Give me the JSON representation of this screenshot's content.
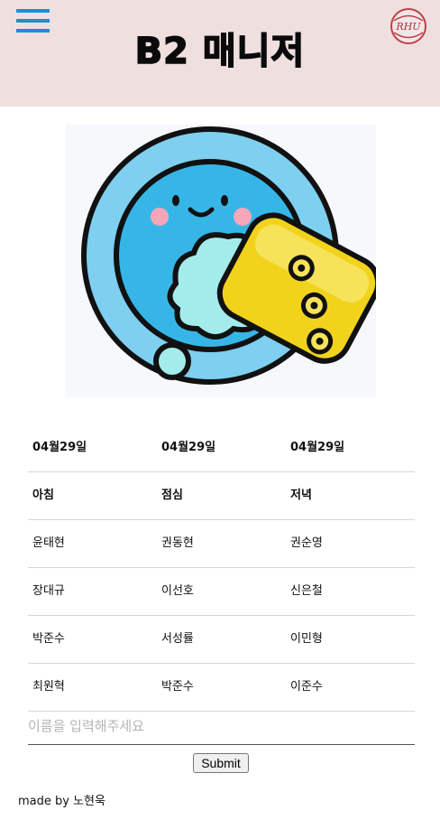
{
  "header": {
    "title": "B2 매니저",
    "logo_text": "RHU"
  },
  "hero": {
    "icon": "dish-washing-sponge-illustration"
  },
  "schedule": {
    "dates": [
      "04월29일",
      "04월29일",
      "04월29일"
    ],
    "meals": [
      "아침",
      "점심",
      "저녁"
    ],
    "rows": [
      [
        "윤태현",
        "권동현",
        "권순영"
      ],
      [
        "장대규",
        "이선호",
        "신은철"
      ],
      [
        "박준수",
        "서성률",
        "이민형"
      ],
      [
        "최원혁",
        "박준수",
        "이준수"
      ]
    ]
  },
  "form": {
    "name_placeholder": "이름을 입력해주세요",
    "name_value": "",
    "submit_label": "Submit"
  },
  "footer": {
    "credit": "made by 노현욱"
  },
  "colors": {
    "header_bg": "#efe0df",
    "menu_icon": "#1a8fd8",
    "logo_ring": "#c0404a"
  }
}
